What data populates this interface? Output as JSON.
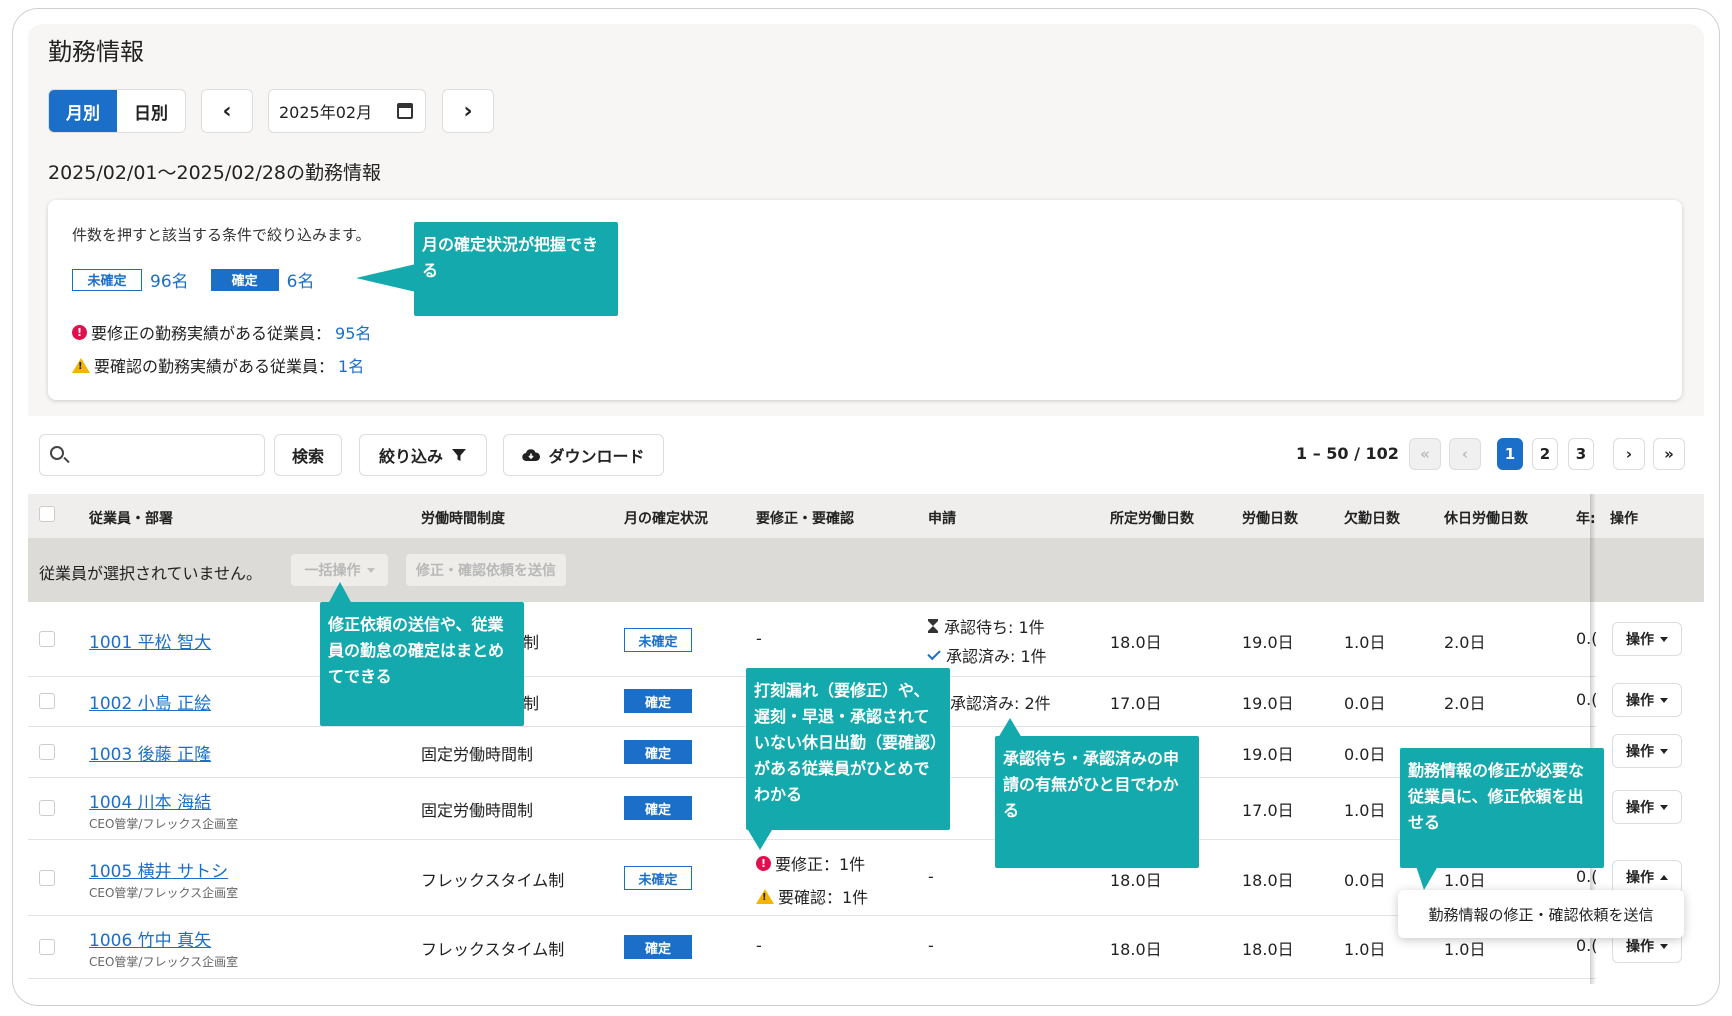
{
  "page": {
    "title": "勤務情報",
    "range_title": "2025/02/01〜2025/02/28の勤務情報"
  },
  "view_toggle": {
    "monthly": "月別",
    "daily": "日別"
  },
  "month_picker": {
    "value": "2025年02月",
    "prev": "‹",
    "next": "›"
  },
  "summary": {
    "hint": "件数を押すと該当する条件で絞り込みます。",
    "unconfirmed_label": "未確定",
    "unconfirmed_count": "96名",
    "confirmed_label": "確定",
    "confirmed_count": "6名",
    "needs_fix_text": "要修正の勤務実績がある従業員：",
    "needs_fix_count": "95名",
    "needs_check_text": "要確認の勤務実績がある従業員：",
    "needs_check_count": "1名"
  },
  "toolbar": {
    "search_placeholder": "",
    "search_button": "検索",
    "filter_button": "絞り込み",
    "download_button": "ダウンロード"
  },
  "pagination": {
    "count": "1 – 50 / 102",
    "first": "«",
    "prev": "‹",
    "pages": [
      "1",
      "2",
      "3"
    ],
    "next": "›",
    "last": "»"
  },
  "table": {
    "headers": [
      "従業員・部署",
      "労働時間制度",
      "月の確定状況",
      "要修正・要確認",
      "申請",
      "所定労働日数",
      "労働日数",
      "欠勤日数",
      "休日労働日数",
      "年:",
      "操作"
    ],
    "bulk_text": "従業員が選択されていません。",
    "bulk_action": "一括操作",
    "bulk_send": "修正・確認依頼を送信",
    "operation_label": "操作",
    "rows": [
      {
        "name": "1001 平松 智大",
        "dept": "",
        "system": "制",
        "status": "未確定",
        "issues": "-",
        "req1": "承認待ち: 1件",
        "req2": "承認済み: 1件",
        "scheduled": "18.0日",
        "worked": "19.0日",
        "absent": "1.0日",
        "holiday": "2.0日",
        "annual": "0.("
      },
      {
        "name": "1002 小島 正絵",
        "dept": "",
        "system": "制",
        "status": "確定",
        "issues": "",
        "req1": "",
        "req2": "承認済み: 2件",
        "scheduled": "17.0日",
        "worked": "19.0日",
        "absent": "0.0日",
        "holiday": "2.0日",
        "annual": "0.("
      },
      {
        "name": "1003 後藤 正隆",
        "dept": "",
        "system": "固定労働時間制",
        "status": "確定",
        "issues": "",
        "req1": "",
        "req2": "",
        "scheduled": "",
        "worked": "19.0日",
        "absent": "0.0日",
        "holiday": "",
        "annual": ""
      },
      {
        "name": "1004 川本 海結",
        "dept": "CEO管掌/フレックス企画室",
        "system": "固定労働時間制",
        "status": "確定",
        "issues": "",
        "req1": "",
        "req2": "",
        "scheduled": "",
        "worked": "17.0日",
        "absent": "1.0日",
        "holiday": "",
        "annual": ""
      },
      {
        "name": "1005 横井 サトシ",
        "dept": "CEO管掌/フレックス企画室",
        "system": "フレックスタイム制",
        "status": "未確定",
        "issue_fix": "要修正：1件",
        "issue_check": "要確認：1件",
        "req1": "-",
        "req2": "",
        "scheduled": "18.0日",
        "worked": "18.0日",
        "absent": "0.0日",
        "holiday": "1.0日",
        "annual": "0.("
      },
      {
        "name": "1006 竹中 真矢",
        "dept": "CEO管掌/フレックス企画室",
        "system": "フレックスタイム制",
        "status": "確定",
        "issues": "-",
        "req1": "-",
        "req2": "",
        "scheduled": "18.0日",
        "worked": "18.0日",
        "absent": "1.0日",
        "holiday": "1.0日",
        "annual": "0.("
      }
    ]
  },
  "dropdown_menu": {
    "item": "勤務情報の修正・確認依頼を送信"
  },
  "callouts": {
    "monthly_status": "月の確定状況が把握できる",
    "bulk": "修正依頼の送信や、従業員の勤怠の確定はまとめてできる",
    "issues": "打刻漏れ（要修正）や、遅刻・早退・承認されていない休日出勤（要確認）がある従業員がひとめでわかる",
    "requests": "承認待ち・承認済みの申請の有無がひと目でわかる",
    "send_request": "勤務情報の修正が必要な従業員に、修正依頼を出せる"
  },
  "colors": {
    "accent": "#1b6fc8",
    "callout": "#14a9ad",
    "error": "#e0104e",
    "warning": "#f4b400"
  }
}
